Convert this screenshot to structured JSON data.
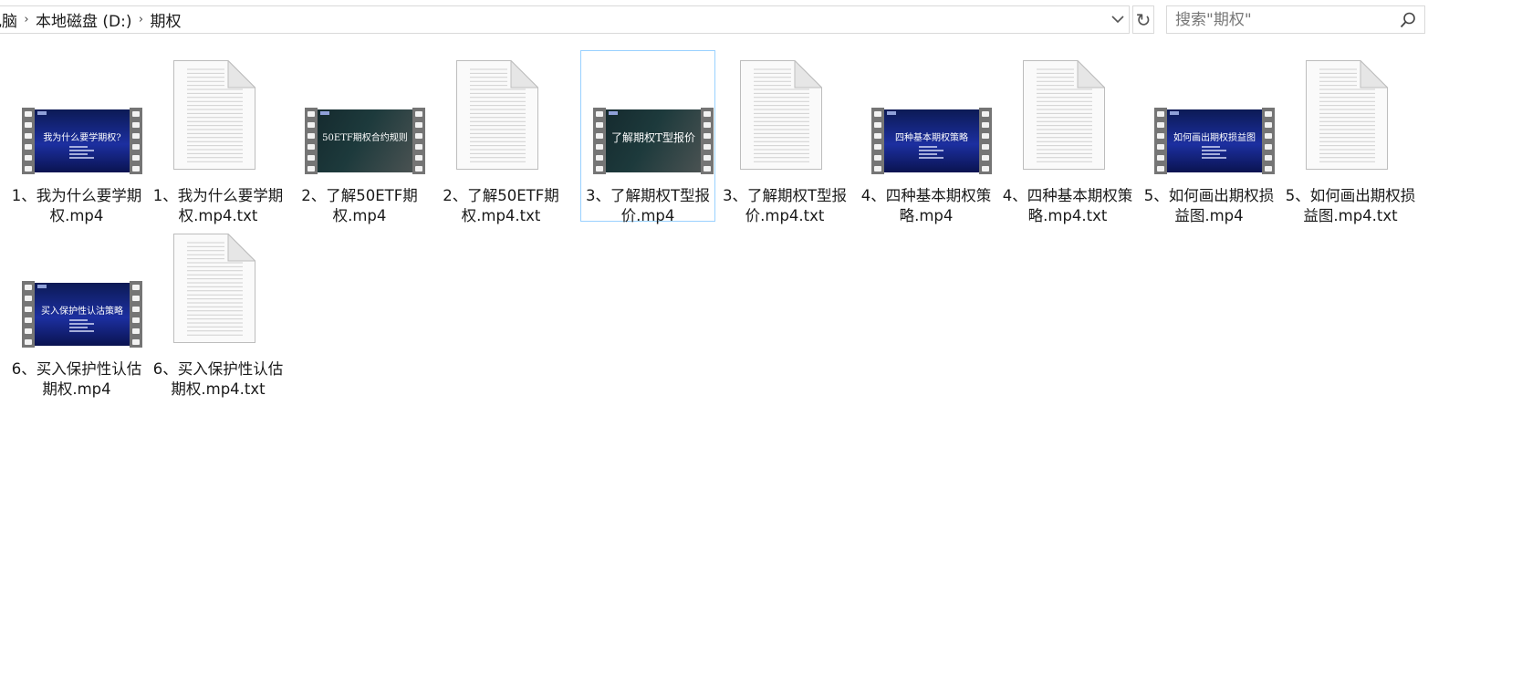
{
  "address_bar": {
    "breadcrumbs": [
      "电脑",
      "本地磁盘 (D:)",
      "期权"
    ]
  },
  "search": {
    "placeholder": "搜索\"期权\""
  },
  "files": [
    {
      "name": "1、我为什么要学期权.mp4",
      "type": "video",
      "thumb_title": "我为什么要学期权?",
      "thumb_style": "blue"
    },
    {
      "name": "1、我为什么要学期权.mp4.txt",
      "type": "text"
    },
    {
      "name": "2、了解50ETF期权.mp4",
      "type": "video",
      "thumb_title": "50ETF期权合约规则",
      "thumb_style": "dark"
    },
    {
      "name": "2、了解50ETF期权.mp4.txt",
      "type": "text"
    },
    {
      "name": "3、了解期权T型报价.mp4",
      "type": "video",
      "thumb_title": "了解期权T型报价",
      "thumb_style": "dark",
      "selected": true
    },
    {
      "name": "3、了解期权T型报价.mp4.txt",
      "type": "text"
    },
    {
      "name": "4、四种基本期权策略.mp4",
      "type": "video",
      "thumb_title": "四种基本期权策略",
      "thumb_style": "blue"
    },
    {
      "name": "4、四种基本期权策略.mp4.txt",
      "type": "text"
    },
    {
      "name": "5、如何画出期权损益图.mp4",
      "type": "video",
      "thumb_title": "如何画出期权损益图",
      "thumb_style": "blue"
    },
    {
      "name": "5、如何画出期权损益图.mp4.txt",
      "type": "text"
    },
    {
      "name": "6、买入保护性认估期权.mp4",
      "type": "video",
      "thumb_title": "买入保护性认沽策略",
      "thumb_style": "blue"
    },
    {
      "name": "6、买入保护性认估期权.mp4.txt",
      "type": "text"
    }
  ]
}
